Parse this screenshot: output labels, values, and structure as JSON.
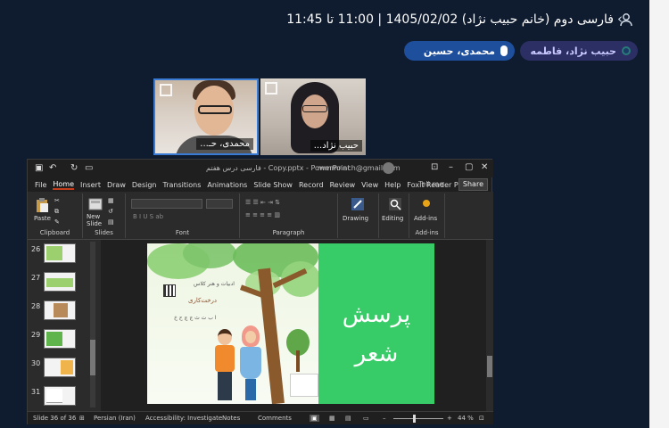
{
  "header": {
    "title": "فارسی دوم (خانم حبیب نژاد) 1405/02/02 | 11:00 تا 11:45",
    "user_icon": "user-icon",
    "chevron": "‹"
  },
  "participants": [
    {
      "name": "حبیب نژاد، فاطمه"
    },
    {
      "name": "محمدی، حسین"
    }
  ],
  "videos": [
    {
      "name": "محمدی، حـ..."
    },
    {
      "name": "حبیب نژاد..."
    }
  ],
  "powerpoint": {
    "file_name": "فارسی درس هفتم - Copy.pptx - PowerPoint",
    "email": "mmmnach@gmail.com",
    "menu": [
      "File",
      "Home",
      "Insert",
      "Draw",
      "Design",
      "Transitions",
      "Animations",
      "Slide Show",
      "Record",
      "Review",
      "View",
      "Help",
      "Foxit Reader PDF"
    ],
    "tell_me": "Tell me",
    "share": "Share",
    "ribbon": {
      "paste": "Paste",
      "new_slide": "New Slide",
      "drawing": "Drawing",
      "editing": "Editing",
      "add_ins": "Add-ins",
      "groups": [
        "Clipboard",
        "Slides",
        "Font",
        "Paragraph",
        "Add-ins"
      ]
    },
    "thumbnails": [
      "26",
      "27",
      "28",
      "29",
      "30",
      "31"
    ],
    "slide": {
      "text_line1": "پرسش",
      "text_line2": "شعر",
      "book_head": "ادبیات و هنر کلاس",
      "book_title": "درخت‌کاری",
      "book_sub": "ا ب ت ث ج چ ح خ"
    },
    "status": {
      "slide_info": "Slide 36 of 36",
      "language": "Persian (Iran)",
      "accessibility": "Accessibility: Investigate",
      "notes": "Notes",
      "comments": "Comments",
      "zoom": "44 %"
    }
  },
  "colors": {
    "background": "#0f1b2e",
    "slide_green": "#37cc67",
    "accent": "#c43e1c"
  }
}
